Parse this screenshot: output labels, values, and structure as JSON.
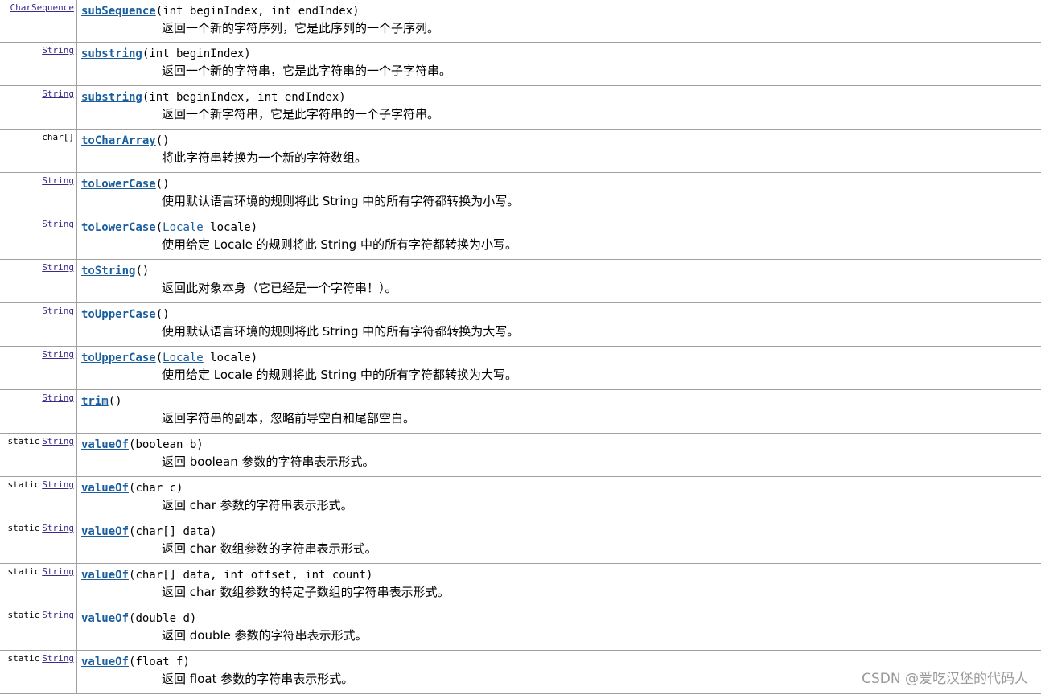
{
  "rows": [
    {
      "modifier": "",
      "return_type": "CharSequence",
      "return_link": true,
      "method": "subSequence",
      "params_before": "(int beginIndex, int endIndex)",
      "param_link": "",
      "params_after": "",
      "description": "返回一个新的字符序列，它是此序列的一个子序列。"
    },
    {
      "modifier": "",
      "return_type": "String",
      "return_link": true,
      "method": "substring",
      "params_before": "(int beginIndex)",
      "param_link": "",
      "params_after": "",
      "description": "返回一个新的字符串，它是此字符串的一个子字符串。"
    },
    {
      "modifier": "",
      "return_type": "String",
      "return_link": true,
      "method": "substring",
      "params_before": "(int beginIndex, int endIndex)",
      "param_link": "",
      "params_after": "",
      "description": "返回一个新字符串，它是此字符串的一个子字符串。"
    },
    {
      "modifier": "",
      "return_type": "char[]",
      "return_link": false,
      "method": "toCharArray",
      "params_before": "()",
      "param_link": "",
      "params_after": "",
      "description": "将此字符串转换为一个新的字符数组。"
    },
    {
      "modifier": "",
      "return_type": "String",
      "return_link": true,
      "method": "toLowerCase",
      "params_before": "()",
      "param_link": "",
      "params_after": "",
      "description": "使用默认语言环境的规则将此 String 中的所有字符都转换为小写。"
    },
    {
      "modifier": "",
      "return_type": "String",
      "return_link": true,
      "method": "toLowerCase",
      "params_before": "(",
      "param_link": "Locale",
      "params_after": " locale)",
      "description": "使用给定 Locale 的规则将此 String 中的所有字符都转换为小写。"
    },
    {
      "modifier": "",
      "return_type": "String",
      "return_link": true,
      "method": "toString",
      "params_before": "()",
      "param_link": "",
      "params_after": "",
      "description": "返回此对象本身（它已经是一个字符串！）。"
    },
    {
      "modifier": "",
      "return_type": "String",
      "return_link": true,
      "method": "toUpperCase",
      "params_before": "()",
      "param_link": "",
      "params_after": "",
      "description": "使用默认语言环境的规则将此 String 中的所有字符都转换为大写。"
    },
    {
      "modifier": "",
      "return_type": "String",
      "return_link": true,
      "method": "toUpperCase",
      "params_before": "(",
      "param_link": "Locale",
      "params_after": " locale)",
      "description": "使用给定 Locale 的规则将此 String 中的所有字符都转换为大写。"
    },
    {
      "modifier": "",
      "return_type": "String",
      "return_link": true,
      "method": "trim",
      "params_before": "()",
      "param_link": "",
      "params_after": "",
      "description": "返回字符串的副本，忽略前导空白和尾部空白。"
    },
    {
      "modifier": "static",
      "return_type": "String",
      "return_link": true,
      "method": "valueOf",
      "params_before": "(boolean b)",
      "param_link": "",
      "params_after": "",
      "description": "返回 boolean 参数的字符串表示形式。"
    },
    {
      "modifier": "static",
      "return_type": "String",
      "return_link": true,
      "method": "valueOf",
      "params_before": "(char c)",
      "param_link": "",
      "params_after": "",
      "description": "返回 char 参数的字符串表示形式。"
    },
    {
      "modifier": "static",
      "return_type": "String",
      "return_link": true,
      "method": "valueOf",
      "params_before": "(char[] data)",
      "param_link": "",
      "params_after": "",
      "description": "返回 char 数组参数的字符串表示形式。"
    },
    {
      "modifier": "static",
      "return_type": "String",
      "return_link": true,
      "method": "valueOf",
      "params_before": "(char[] data, int offset, int count)",
      "param_link": "",
      "params_after": "",
      "description": "返回 char 数组参数的特定子数组的字符串表示形式。"
    },
    {
      "modifier": "static",
      "return_type": "String",
      "return_link": true,
      "method": "valueOf",
      "params_before": "(double d)",
      "param_link": "",
      "params_after": "",
      "description": "返回 double 参数的字符串表示形式。"
    },
    {
      "modifier": "static",
      "return_type": "String",
      "return_link": true,
      "method": "valueOf",
      "params_before": "(float f)",
      "param_link": "",
      "params_after": "",
      "description": "返回 float 参数的字符串表示形式。"
    }
  ],
  "watermark": "CSDN @爱吃汉堡的代码人",
  "colors": {
    "method_link": "#1a5e9e",
    "type_link": "#3b2a8b",
    "border": "#a0a0a0"
  }
}
